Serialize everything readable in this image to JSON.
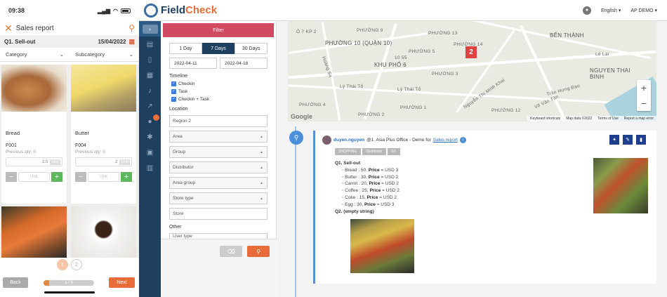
{
  "mobile": {
    "status": {
      "time": "09:38"
    },
    "header": {
      "title": "Sales report"
    },
    "section": {
      "question": "Q1. Sell-out",
      "date": "15/04/2022"
    },
    "filters": {
      "category": "Category",
      "subcategory": "Subcategory"
    },
    "products": [
      {
        "name": "Bread",
        "code": "F001",
        "previous": "Previous qty: 0",
        "qty": "2.5",
        "unit": "Unit",
        "unit_sel": "Unit"
      },
      {
        "name": "Butter",
        "code": "F004",
        "previous": "Previous qty: 0",
        "qty": "2",
        "unit": "Unit",
        "unit_sel": "Unit"
      },
      {
        "name": "",
        "code": "",
        "previous": "",
        "qty": "",
        "unit": "",
        "unit_sel": ""
      },
      {
        "name": "",
        "code": "",
        "previous": "",
        "qty": "",
        "unit": "",
        "unit_sel": ""
      }
    ],
    "pager": {
      "p1": "1",
      "p2": "2"
    },
    "footer": {
      "back": "Back",
      "progress": "1 / 9",
      "progress_fraction": 0.111,
      "next": "Next"
    }
  },
  "app": {
    "brand_a": "Field",
    "brand_b": "Check",
    "language": "English",
    "user": "AP DEMO"
  },
  "filter": {
    "title": "Filter",
    "days": [
      "1 Day",
      "7 Days",
      "30 Days"
    ],
    "from": "2022-04-11",
    "to": "2022-04-18",
    "timeline_label": "Timeline",
    "timeline": [
      "Checkin",
      "Task",
      "Checkin + Task"
    ],
    "location_label": "Location",
    "region": "Region 2",
    "fields": [
      "Area",
      "Group",
      "Distributor",
      "Area group",
      "Store type"
    ],
    "store": "Store",
    "other_label": "Other",
    "user_type": "User type"
  },
  "map": {
    "labels": [
      "PHƯỜNG 10 (QUẬN 10)",
      "KHU PHỐ 6",
      "BẾN THÀNH",
      "NGUYEN THAI BINH",
      "Ô 7 KP 2",
      "10 55",
      "PHƯỜNG 13",
      "PHƯỜNG 5",
      "PHƯỜNG 3",
      "PHƯỜNG 9",
      "Lý Thái Tổ",
      "Lý Thái Tổ",
      "PHƯỜNG 1",
      "PHƯỜNG 14",
      "PHƯỜNG 2",
      "Lê Lai",
      "Nguyễn Thị Minh Khai",
      "Võ Văn Tần",
      "Trần Hưng Đạo",
      "PHƯỜNG 12",
      "PHƯỜNG 4",
      "Hoàng Sa"
    ],
    "cluster": "2",
    "attribution": [
      "Keyboard shortcuts",
      "Map data ©2022",
      "Terms of Use",
      "Report a map error"
    ],
    "google": "Google"
  },
  "post": {
    "user": "duyen.nguyen",
    "location": "@1. Asia Plus Office - Demo for",
    "report": "Sales report",
    "tags": [
      "SHOPPING",
      "Distributor",
      "GT"
    ],
    "q1": "Q1.   Sell-out",
    "items": [
      {
        "name": "Bread : 50,",
        "price_label": "Price",
        "price": "= USD 3"
      },
      {
        "name": "Butter : 30,",
        "price_label": "Price",
        "price": "= USD 2"
      },
      {
        "name": "Carrot : 20,",
        "price_label": "Price",
        "price": "= USD 2"
      },
      {
        "name": "Coffee : 25,",
        "price_label": "Price",
        "price": "= USD 2"
      },
      {
        "name": "Coke : 15,",
        "price_label": "Price",
        "price": "= USD 2"
      },
      {
        "name": "Egg : 30,",
        "price_label": "Price",
        "price": "= USD 3"
      }
    ],
    "q2": "Q2.   (empty string)"
  }
}
